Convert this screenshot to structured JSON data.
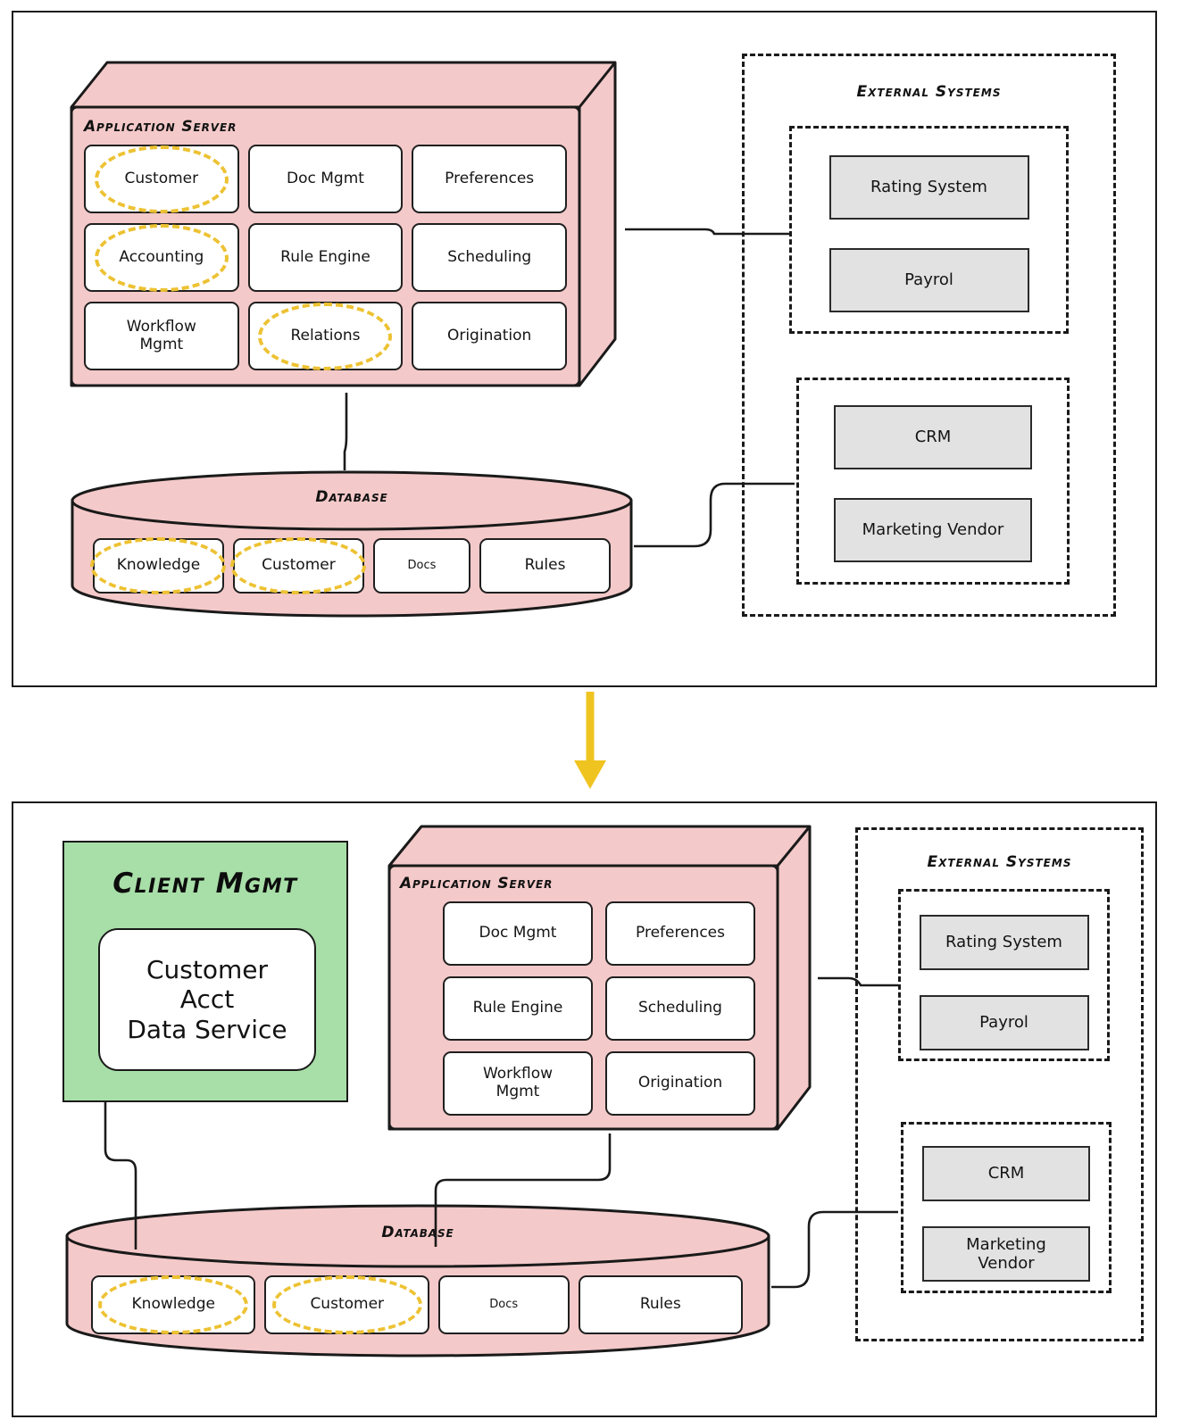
{
  "diagram": {
    "title_font_note": "",
    "accent_highlight_color": "#edc233",
    "arrow_color": "#f0c420",
    "server_fill": "#f4c9c9",
    "client_fill": "#a8dfa8",
    "external_box_fill": "#e2e2e2"
  },
  "top_panel": {
    "app_server": {
      "title": "Application Server",
      "modules": [
        {
          "label": "Customer",
          "highlighted": true
        },
        {
          "label": "Doc Mgmt",
          "highlighted": false
        },
        {
          "label": "Preferences",
          "highlighted": false
        },
        {
          "label": "Accounting",
          "highlighted": true
        },
        {
          "label": "Rule Engine",
          "highlighted": false
        },
        {
          "label": "Scheduling",
          "highlighted": false
        },
        {
          "label": "Workflow\nMgmt",
          "highlighted": false
        },
        {
          "label": "Relations",
          "highlighted": true
        },
        {
          "label": "Origination",
          "highlighted": false
        }
      ]
    },
    "database": {
      "title": "Database",
      "stores": [
        {
          "label": "Knowledge",
          "highlighted": true,
          "small": false
        },
        {
          "label": "Customer",
          "highlighted": true,
          "small": false
        },
        {
          "label": "Docs",
          "highlighted": false,
          "small": true
        },
        {
          "label": "Rules",
          "highlighted": false,
          "small": false
        }
      ]
    },
    "external_systems": {
      "title": "External Systems",
      "groups": [
        {
          "items": [
            "Rating System",
            "Payrol"
          ]
        },
        {
          "items": [
            "CRM",
            "Marketing Vendor"
          ]
        }
      ]
    }
  },
  "transition_arrow": {
    "direction": "down"
  },
  "bottom_panel": {
    "client_mgmt": {
      "title": "Client Mgmt",
      "service": "Customer\nAcct\nData Service"
    },
    "app_server": {
      "title": "Application Server",
      "modules": [
        {
          "label": "Doc Mgmt",
          "highlighted": false
        },
        {
          "label": "Preferences",
          "highlighted": false
        },
        {
          "label": "Rule Engine",
          "highlighted": false
        },
        {
          "label": "Scheduling",
          "highlighted": false
        },
        {
          "label": "Workflow\nMgmt",
          "highlighted": false
        },
        {
          "label": "Origination",
          "highlighted": false
        }
      ]
    },
    "database": {
      "title": "Database",
      "stores": [
        {
          "label": "Knowledge",
          "highlighted": true,
          "small": false
        },
        {
          "label": "Customer",
          "highlighted": true,
          "small": false
        },
        {
          "label": "Docs",
          "highlighted": false,
          "small": true
        },
        {
          "label": "Rules",
          "highlighted": false,
          "small": false
        }
      ]
    },
    "external_systems": {
      "title": "External Systems",
      "groups": [
        {
          "items": [
            "Rating System",
            "Payrol"
          ]
        },
        {
          "items": [
            "CRM",
            "Marketing\nVendor"
          ]
        }
      ]
    }
  }
}
